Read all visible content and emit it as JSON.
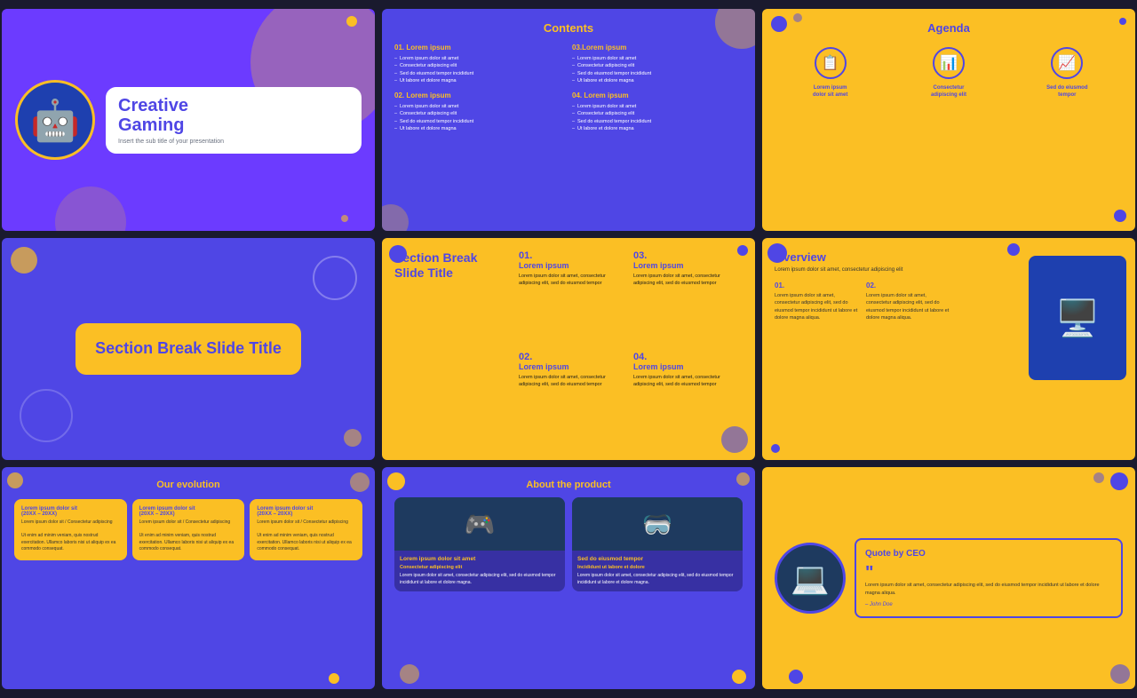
{
  "slides": {
    "slide1": {
      "title": "Creative",
      "title2": "Gaming",
      "subtitle": "Insert the sub title of your presentation"
    },
    "slide2": {
      "title": "Contents",
      "sections": [
        {
          "num": "01.",
          "heading": "Lorem ipsum",
          "items": [
            "Lorem ipsum dolor sit amet",
            "Consectetur adipiscing elit",
            "Sed do eiusmod tempor incididunt",
            "Ut labore et dolore magna"
          ]
        },
        {
          "num": "03.",
          "heading": "Lorem ipsum",
          "items": [
            "Lorem ipsum dolor sit amet",
            "Consectetur adipiscing elit",
            "Sed do eiusmod tempor incididunt",
            "Ut labore et dolore magna"
          ]
        },
        {
          "num": "02.",
          "heading": "Lorem ipsum",
          "items": [
            "Lorem ipsum dolor sit amet",
            "Consectetur adipiscing elit",
            "Sed do eiusmod tempor incididunt",
            "Ut labore et dolore magna"
          ]
        },
        {
          "num": "04.",
          "heading": "Lorem ipsum",
          "items": [
            "Lorem ipsum dolor sit amet",
            "Consectetur adipiscing elit",
            "Sed do eiusmod tempor incididunt",
            "Ut labore et dolore magna"
          ]
        }
      ]
    },
    "slide3": {
      "title": "Agenda",
      "items": [
        {
          "icon": "📋",
          "label": "Lorem ipsum dolor sit amet"
        },
        {
          "icon": "📊",
          "label": "Consectetur adipiscing elit"
        },
        {
          "icon": "📈",
          "label": "Sed do eiusmod tempor"
        }
      ]
    },
    "slide4": {
      "title": "Section Break Slide Title"
    },
    "slide5": {
      "title": "Section Break Slide Title",
      "sections": [
        {
          "num": "01.",
          "heading": "Lorem ipsum",
          "text": "Lorem ipsum dolor sit amet, consectetur adipiscing elit, sed do eiusmod tempor"
        },
        {
          "num": "03.",
          "heading": "Lorem ipsum",
          "text": "Lorem ipsum dolor sit amet, consectetur adipiscing elit, sed do eiusmod tempor"
        },
        {
          "num": "02.",
          "heading": "Lorem ipsum",
          "text": "Lorem ipsum dolor sit amet, consectetur adipiscing elit, sed do eiusmod tempor"
        },
        {
          "num": "04.",
          "heading": "Lorem ipsum",
          "text": "Lorem ipsum dolor sit amet, consectetur adipiscing elit, sed do eiusmod tempor"
        }
      ]
    },
    "slide6": {
      "title": "Overview",
      "subtitle": "Lorem ipsum dolor sit amet, consectetur adipiscing elit",
      "items": [
        {
          "num": "01.",
          "text": "Lorem ipsum dolor sit amet, consectetur adipiscing elit, sed do eiusmod tempor incididunt ut labore et dolore magna aliqua."
        },
        {
          "num": "02.",
          "text": "Lorem ipsum dolor sit amet, consectetur adipiscing elit, sed do eiusmod tempor incididunt ut labore et dolore magna aliqua."
        }
      ]
    },
    "slide7": {
      "title": "Our evolution",
      "cards": [
        {
          "heading": "Lorem ipsum dolor sit (20XX – 20XX)",
          "text": "Lorem ipsum dolor sit / Consectetur adipiscing\n\nUt enim ad minim veniam, quis nostrud exercitation. Ullamco laboris nisi ut aliquip ex ea commodo consequat."
        },
        {
          "heading": "Lorem ipsum dolor sit (20XX – 20XX)",
          "text": "Lorem ipsum dolor sit / Consectetur adipiscing\n\nUt enim ad minim veniam, quis nostrud exercitation. Ullamco laboris nisi ut aliquip ex ea commodo consequat."
        },
        {
          "heading": "Lorem ipsum dolor sit (20XX – 20XX)",
          "text": "Lorem ipsum dolor sit / Consectetur adipiscing\n\nUt enim ad minim veniam, quis nostrud exercitation. Ullamco laboris nisi ut aliquip ex ea commodo consequat."
        }
      ]
    },
    "slide8": {
      "title": "About the product",
      "products": [
        {
          "icon": "🎮",
          "heading": "Lorem ipsum dolor sit amet",
          "subheading": "Consectetur adipiscing elit",
          "text": "Lorem ipsum dolor sit amet, consectetur adipiscing elit, sed do eiusmod tempor incididunt ut labore et dolore magna."
        },
        {
          "icon": "🥽",
          "heading": "Sed do eiusmod tempor",
          "subheading": "Incididunt ut labore et dolore",
          "text": "Lorem ipsum dolor sit amet, consectetur adipiscing elit, sed do eiusmod tempor incididunt ut labore et dolore magna."
        }
      ]
    },
    "slide9": {
      "title": "Quote by CEO",
      "quote": "Lorem ipsum dolor sit amet, consectetur adipiscing elit, sed do eiusmod tempor incididunt ut labore et dolore magna aliqua.",
      "author": "– John Doe"
    }
  },
  "colors": {
    "purple": "#4f46e5",
    "yellow": "#fbbf24",
    "white": "#ffffff",
    "dark": "#1a1a2e"
  }
}
